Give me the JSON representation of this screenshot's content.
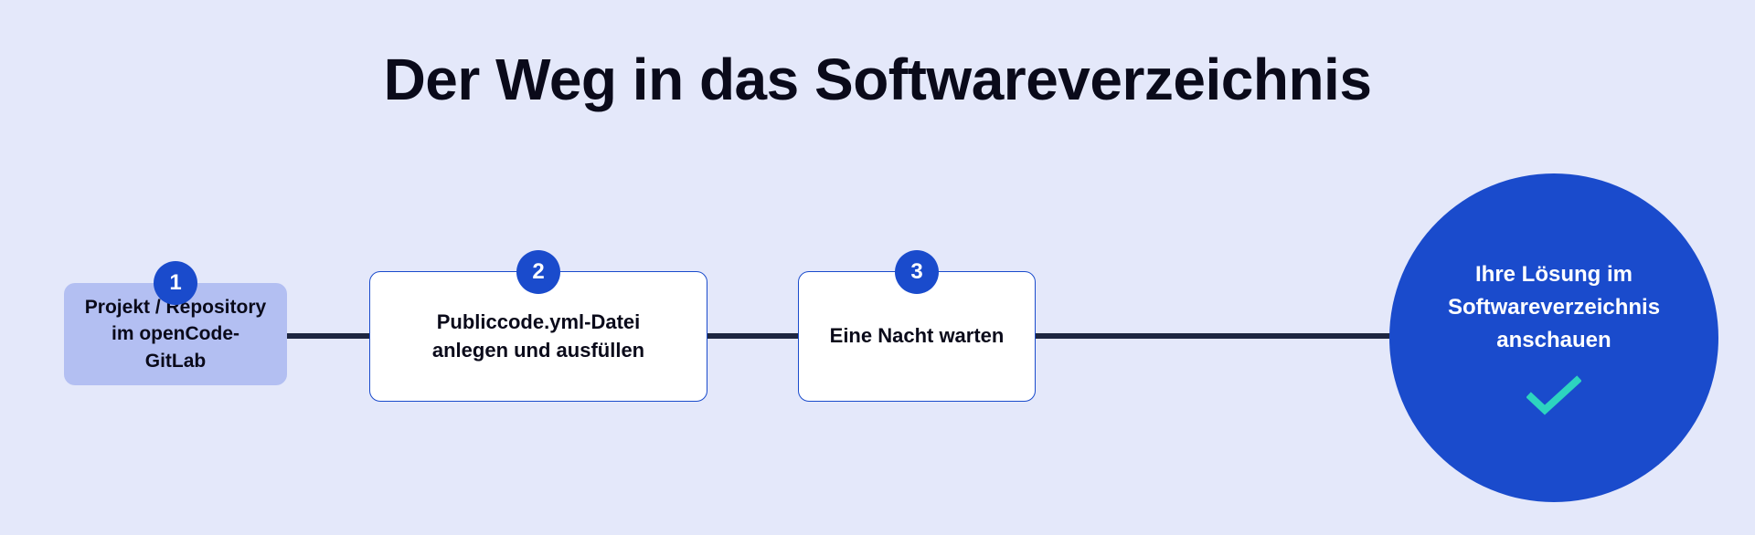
{
  "title": "Der Weg in das Softwareverzeichnis",
  "steps": [
    {
      "number": "1",
      "text": "Projekt / Repository\nim openCode-GitLab"
    },
    {
      "number": "2",
      "text": "Publiccode.yml-Datei\nanlegen und ausfüllen"
    },
    {
      "number": "3",
      "text": "Eine Nacht warten"
    }
  ],
  "final": {
    "text": "Ihre Lösung im\nSoftwareverzeichnis\nanschauen"
  },
  "colors": {
    "background": "#e4e8fa",
    "accent": "#1a4bcc",
    "highlight": "#b3bff2",
    "connector": "#1e2640",
    "checkmark": "#2dd4bf"
  }
}
